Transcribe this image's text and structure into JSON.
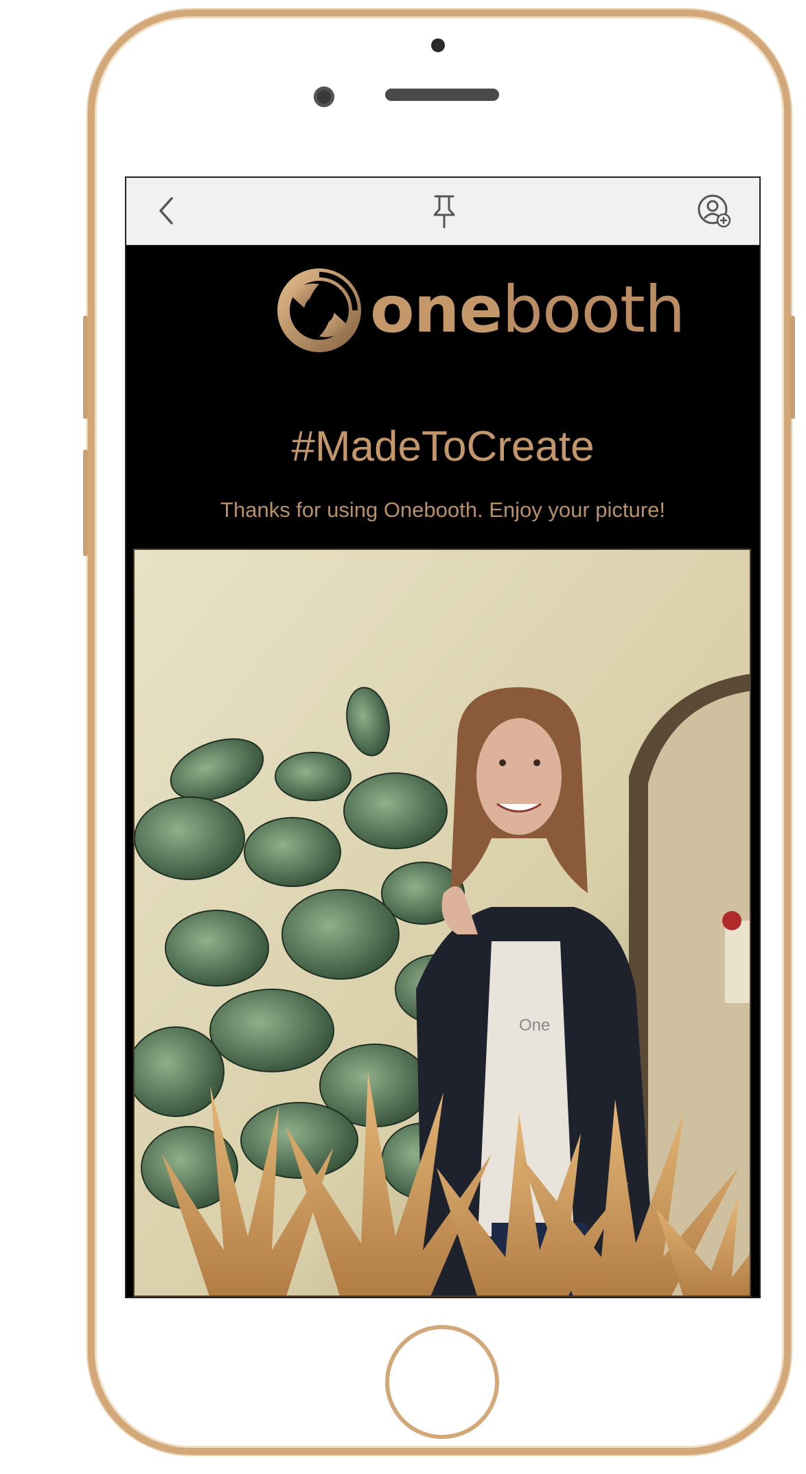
{
  "nav": {
    "back_icon": "chevron-left-icon",
    "pin_icon": "pin-icon",
    "profile_icon": "user-add-icon"
  },
  "brand": {
    "logo_icon": "onebooth-aperture-logo",
    "name_bold": "one",
    "name_light": "booth"
  },
  "content": {
    "hashtag": "#MadeToCreate",
    "tagline": "Thanks for using Onebooth. Enjoy your picture!"
  },
  "photo": {
    "subject": "photo-booth-picture",
    "shirt_text": "One"
  },
  "colors": {
    "gold": "#c5986a",
    "screen_bg": "#000000",
    "navbar_bg": "#f1f1f2",
    "phone_frame": "#d2a878"
  }
}
